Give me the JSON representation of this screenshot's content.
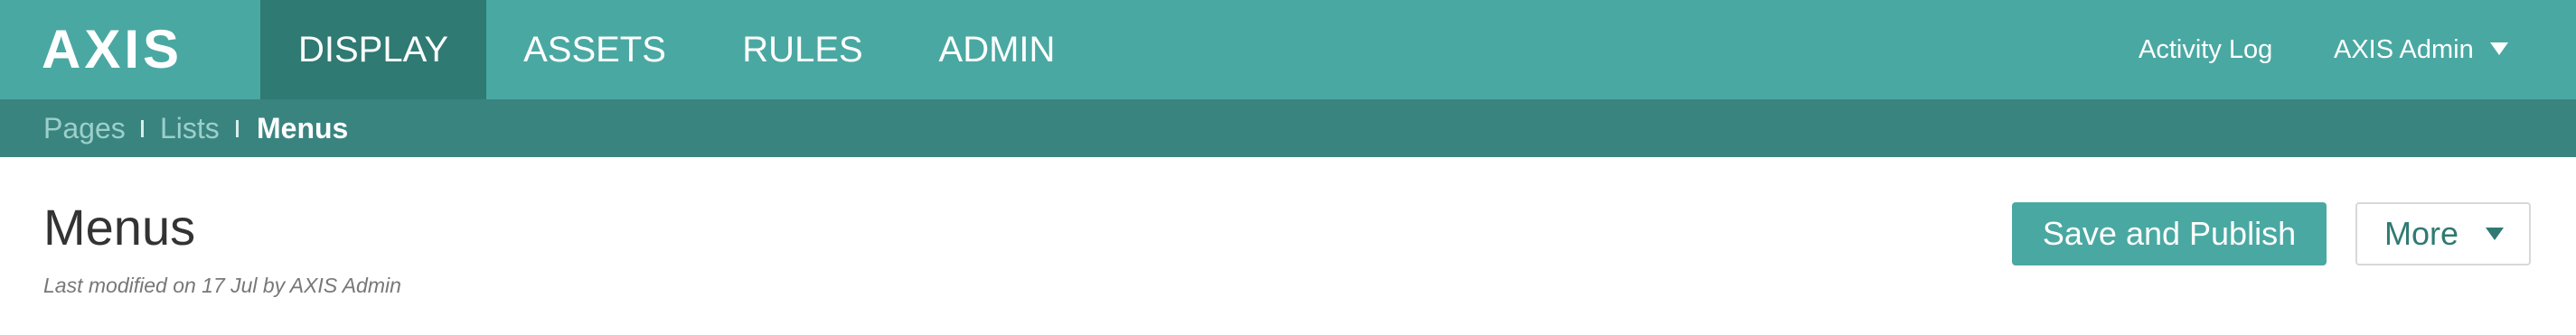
{
  "app": {
    "logo_text": "AXIS"
  },
  "nav": {
    "items": [
      {
        "label": "DISPLAY",
        "active": true
      },
      {
        "label": "ASSETS",
        "active": false
      },
      {
        "label": "RULES",
        "active": false
      },
      {
        "label": "ADMIN",
        "active": false
      }
    ],
    "activity_log": "Activity Log",
    "user_menu": "AXIS Admin",
    "user_menu_icon": "chevron-down-icon"
  },
  "breadcrumb": {
    "items": [
      {
        "label": "Pages",
        "current": false
      },
      {
        "label": "Lists",
        "current": false
      },
      {
        "label": "Menus",
        "current": true
      }
    ]
  },
  "main": {
    "title": "Menus",
    "last_modified": "Last modified on 17 Jul by AXIS Admin",
    "save_publish_button": "Save and Publish",
    "more_button": "More",
    "more_button_icon": "chevron-down-icon"
  },
  "colors": {
    "top_nav_bg": "#4aa8a2",
    "active_nav_bg": "#2f7a73",
    "breadcrumb_bg": "#3a8480",
    "primary_button_bg": "#4aa8a2"
  }
}
